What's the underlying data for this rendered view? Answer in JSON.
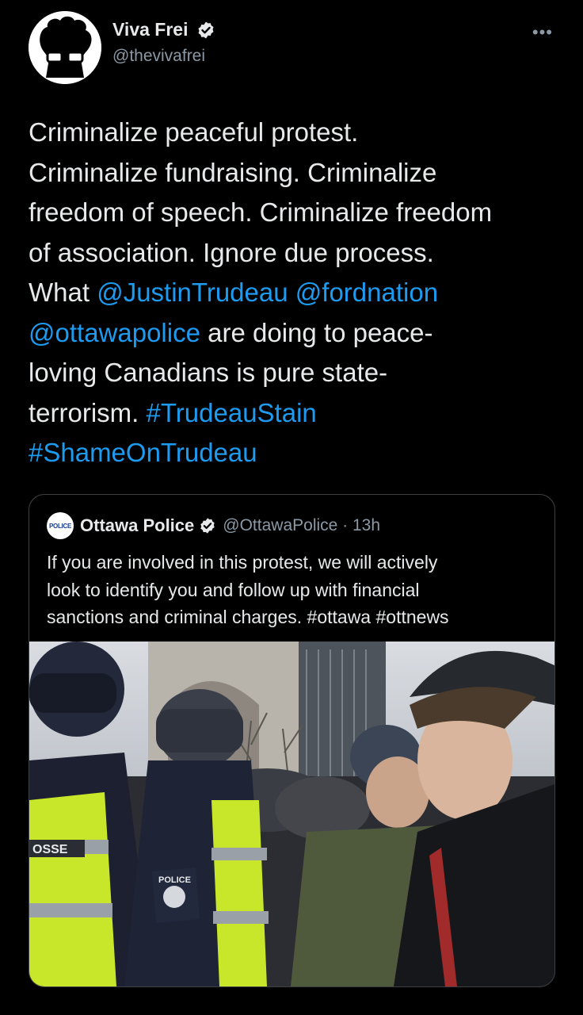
{
  "author": {
    "display_name": "Viva Frei",
    "handle": "@thevivafrei",
    "avatar_icon": "afro-glasses-silhouette-icon",
    "verified_icon": "verified-badge-icon"
  },
  "more_icon": "more-options-icon",
  "tweet": {
    "lines": [
      "Criminalize peaceful protest.",
      "Criminalize fundraising. Criminalize",
      "freedom of speech. Criminalize freedom",
      "of association. Ignore due process."
    ],
    "what": "What ",
    "mention_1": "@JustinTrudeau",
    "space_1": " ",
    "mention_2": "@fordnation",
    "mention_3": "@ottawapolice",
    "after_mention_3": " are doing to peace-",
    "line_8": "loving Canadians is pure state-",
    "line_9": "terrorism. ",
    "hashtag_1": "#TrudeauStain",
    "hashtag_2": "#ShameOnTrudeau"
  },
  "quoted": {
    "avatar_text": "POLICE",
    "display_name": "Ottawa Police",
    "handle_time": "@OttawaPolice · 13h",
    "text_lines": [
      "If you are involved in this protest, we will actively",
      "look to identify you and follow up with financial",
      "sanctions and criminal charges. #ottawa #ottnews"
    ],
    "photo_description_icon": "protest-police-photo",
    "vest_left_text": "OSSE",
    "badge_text": "POLICE"
  },
  "colors": {
    "background": "#000000",
    "text": "#e7e9ea",
    "link": "#1d9bf0",
    "secondary": "#8b98a5",
    "vest": "#c8e62a"
  }
}
